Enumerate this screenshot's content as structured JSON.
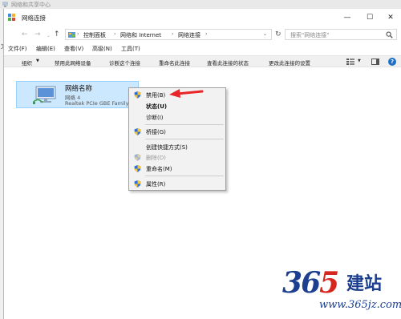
{
  "background": {
    "title": "网络和共享中心",
    "left_text": "文"
  },
  "window": {
    "title": "网络连接",
    "controls": {
      "minimize": "—",
      "maximize": "☐",
      "close": "✕"
    }
  },
  "nav": {
    "back": "←",
    "forward": "→",
    "history": "⌄",
    "up": "↑"
  },
  "address": {
    "crumbs": [
      "控制面板",
      "网络和 Internet",
      "网络连接"
    ],
    "separator": "›",
    "dropdown": "⌄",
    "refresh": "↻"
  },
  "search": {
    "placeholder": "搜索\"网络连接\""
  },
  "menu": [
    "文件(F)",
    "编辑(E)",
    "查看(V)",
    "高级(N)",
    "工具(T)"
  ],
  "commands": {
    "organize": "组织",
    "organize_arrow": "▼",
    "items": [
      "禁用此网络设备",
      "诊断这个连接",
      "重命名此连接",
      "查看此连接的状态",
      "更改此连接的设置"
    ],
    "view_dd": "▼",
    "help": "?"
  },
  "adapter": {
    "name": "网络名称",
    "network": "网络 4",
    "device": "Realtek PCIe GBE Family Controller"
  },
  "context_menu": {
    "disable": "禁用(B)",
    "status": "状态(U)",
    "diagnose": "诊断(I)",
    "bridge": "桥接(G)",
    "shortcut": "创建快捷方式(S)",
    "delete": "删除(D)",
    "rename": "重命名(M)",
    "properties": "属性(R)"
  },
  "watermark": {
    "d1": "3",
    "d2": "6",
    "d3": "5",
    "jian": "建站",
    "url": "www.365jz.com"
  },
  "colors": {
    "selection": "#cce8ff",
    "arrow": "#e8262a",
    "watermark_blue": "#1c3f8f",
    "watermark_red": "#d7261e"
  }
}
